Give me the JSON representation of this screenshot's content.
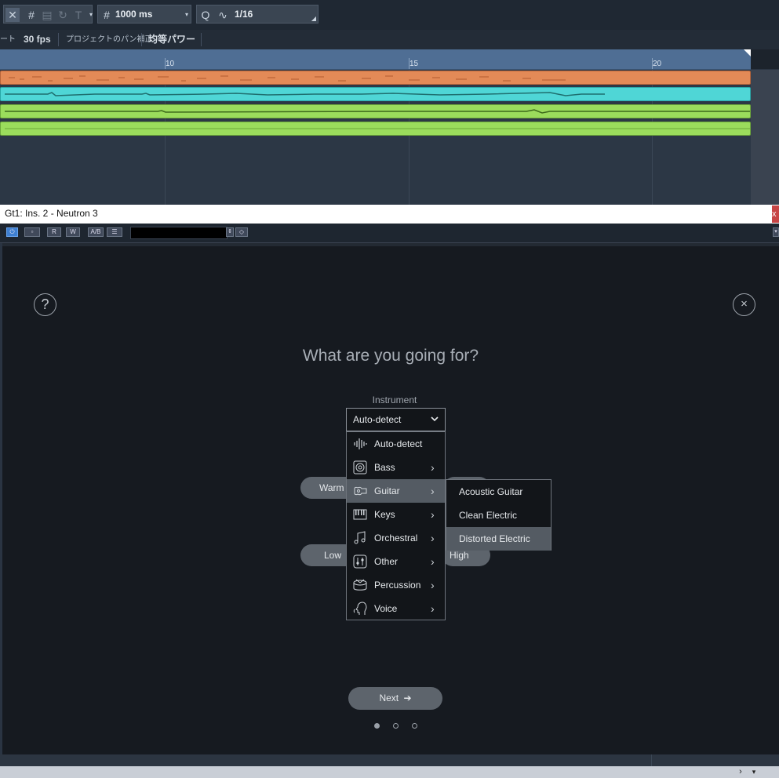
{
  "toolbar": {
    "grid_value": "1000 ms",
    "quantize_value": "1/16"
  },
  "infobar": {
    "partial_label": "ート",
    "fps": "30 fps",
    "pan_law_label": "プロジェクトのパン補正",
    "pan_law_value": "均等パワー"
  },
  "ruler": {
    "ticks": [
      "10",
      "15",
      "20"
    ]
  },
  "tracks": [
    {
      "color": "#e38a57"
    },
    {
      "color": "#4fd6d6"
    },
    {
      "color": "#9bdc5c"
    },
    {
      "color": "#9bdc5c"
    }
  ],
  "plugin": {
    "window_title": "Gt1: Ins. 2 - Neutron 3",
    "title_close": "x",
    "controls": [
      "R",
      "W",
      "A/B"
    ],
    "question": "What are you going for?",
    "instrument_label": "Instrument",
    "dropdown_value": "Auto-detect",
    "menu_items": [
      {
        "label": "Auto-detect",
        "icon": "waveform-icon",
        "has_submenu": false
      },
      {
        "label": "Bass",
        "icon": "speaker-icon",
        "has_submenu": true
      },
      {
        "label": "Guitar",
        "icon": "guitar-icon",
        "has_submenu": true,
        "selected": true
      },
      {
        "label": "Keys",
        "icon": "piano-keys-icon",
        "has_submenu": true
      },
      {
        "label": "Orchestral",
        "icon": "music-note-icon",
        "has_submenu": true
      },
      {
        "label": "Other",
        "icon": "sliders-icon",
        "has_submenu": true
      },
      {
        "label": "Percussion",
        "icon": "drum-icon",
        "has_submenu": true
      },
      {
        "label": "Voice",
        "icon": "voice-head-icon",
        "has_submenu": true
      }
    ],
    "submenu_items": [
      {
        "label": "Acoustic Guitar"
      },
      {
        "label": "Clean Electric"
      },
      {
        "label": "Distorted Electric",
        "selected": true
      }
    ],
    "pills": {
      "warm": "Warm",
      "low": "Low",
      "high": "High"
    },
    "next_label": "Next",
    "page_dots": 3,
    "active_dot": 0
  },
  "colors": {
    "ruler": "#4f6e94",
    "plugin_bg": "#161a20",
    "menu_selected": "#545b63"
  }
}
